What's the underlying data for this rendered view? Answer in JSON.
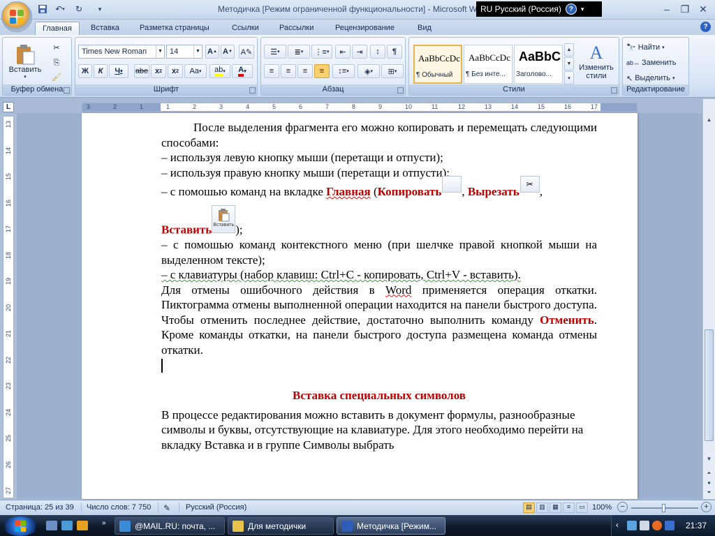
{
  "window": {
    "title": "Методичка [Режим ограниченной функциональности] - Microsoft Word",
    "language_bar": "RU Русский (Россия)",
    "language_help": "?"
  },
  "tabs": [
    "Главная",
    "Вставка",
    "Разметка страницы",
    "Ссылки",
    "Рассылки",
    "Рецензирование",
    "Вид"
  ],
  "ribbon": {
    "clipboard": {
      "label": "Буфер обмена",
      "paste": "Вставить"
    },
    "font": {
      "label": "Шрифт",
      "name": "Times New Roman",
      "size": "14"
    },
    "paragraph": {
      "label": "Абзац"
    },
    "styles": {
      "label": "Стили",
      "items": [
        {
          "preview": "AaBbCcDc",
          "name": "¶ Обычный"
        },
        {
          "preview": "AaBbCcDc",
          "name": "¶ Без инте..."
        },
        {
          "preview": "AaBbC",
          "name": "Заголово..."
        }
      ],
      "change": "Изменить стили"
    },
    "editing": {
      "label": "Редактирование",
      "find": "Найти",
      "replace": "Заменить",
      "select": "Выделить"
    }
  },
  "document": {
    "p1": "После выделения фрагмента его можно копировать и перемещать следующими способами:",
    "l1": "– используя левую кнопку мыши (перетащи и отпусти);",
    "l2": "– используя правую кнопку мыши (перетащи и отпусти);",
    "l3_pre": "– с помошью команд на вкладке ",
    "l3_home": "Главная",
    "l3_mid": " (",
    "l3_copy": "Копировать",
    "l3_comma": ", ",
    "l3_cut": "Вырезать",
    "l3_end": ",",
    "paste_word": "Вставить",
    "paste_icon_label": "Вставить",
    "paste_close": ");",
    "l4": "– с помошью команд контекстного меню (при шелчке правой кнопкой мыши на выделенном тексте);",
    "l5": "– с клавиатуры (набор клавиш: Ctrl+C - копировать, Ctrl+V - вставить).",
    "p2_a": "Для отмены ошибочного действия в ",
    "p2_word": "Word",
    "p2_b": " применяется операция откатки. Пиктограмма отмены выполненной операции находится на панели быстрого доступа. Чтобы отменить последнее действие, достаточно выполнить команду ",
    "p2_cancel": "Отменить",
    "p2_c": ". Кроме команды откатки, на панели быстрого доступа размещена команда отмены откатки.",
    "heading": "Вставка специальных символов",
    "p3": "В процессе редактирования можно вставить в документ формулы, разнообразные символы и буквы, отсутствующие на клавиатуре. Для этого необходимо перейти на вкладку Вставка и в группе Символы выбрать"
  },
  "ruler": {
    "h": [
      "3",
      "2",
      "1",
      "1",
      "2",
      "3",
      "4",
      "5",
      "6",
      "7",
      "8",
      "9",
      "10",
      "11",
      "12",
      "13",
      "14",
      "15",
      "16",
      "17"
    ],
    "v": [
      "13",
      "14",
      "15",
      "16",
      "17",
      "18",
      "19",
      "20",
      "21",
      "22",
      "23",
      "24",
      "25",
      "26",
      "27"
    ]
  },
  "status": {
    "page": "Страница: 25 из 39",
    "words": "Число слов: 7 750",
    "lang": "Русский (Россия)",
    "zoom": "100%"
  },
  "taskbar": {
    "tasks": [
      "@MAIL.RU: почта, ...",
      "Для методички",
      "Методичка [Режим..."
    ],
    "clock": "21:37"
  },
  "colors": {
    "accent_red": "#c00000",
    "ribbon_blue": "#dbe7f6",
    "taskbar": "#0f1a2a"
  }
}
